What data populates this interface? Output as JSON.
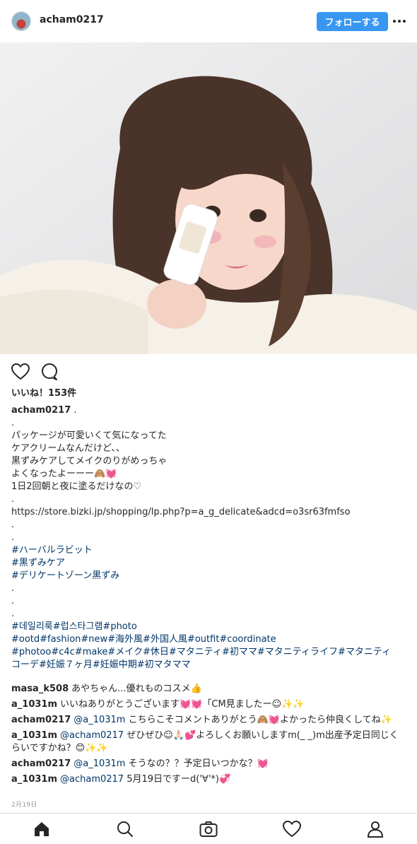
{
  "header": {
    "username": "acham0217",
    "follow_label": "フォローする"
  },
  "post": {
    "likes_label": "いいね！153件",
    "caption_author": "acham0217",
    "caption_lines": [
      ".",
      ".",
      "パッケージが可愛いくて気になってた",
      "ケアクリームなんだけど、、",
      "黒ずみケアしてメイクのりがめっちゃ",
      "よくなったよーーー🙈💓",
      "1日2回朝と夜に塗るだけなの♡",
      ".",
      "https://store.bizki.jp/shopping/lp.php?p=a_g_delicate&adcd=o3sr63fmfso",
      ".",
      ".",
      "#ハーバルラビット",
      "#黒ずみケア",
      "#デリケートゾーン黒ずみ",
      ".",
      ".",
      ".",
      "#데일리룩#럽스타그램#photo",
      "#ootd#fashion#new#海外風#外国人風#outfit#coordinate",
      "#photoo#c4c#make#メイク#休日#マタニティ#初ママ#マタニティライフ#マタニティ",
      "コーデ#妊娠７ヶ月#妊娠中期#初マタママ"
    ],
    "date": "2月19日"
  },
  "comments": [
    {
      "user": "masa_k508",
      "text": "あやちゃん...優れものコスメ👍"
    },
    {
      "user": "a_1031m",
      "text": "いいねありがとうございます💓💓「CM見ましたー☺✨✨"
    },
    {
      "user": "acham0217",
      "mention": "@a_1031m",
      "text": " こちらこそコメントありがとう🙈💓よかったら仲良くしてね✨"
    },
    {
      "user": "a_1031m",
      "mention": "@acham0217",
      "text": " ぜひぜひ☺🙏🏻💕よろしくお願いしますm(_ _)m出産予定日同じくらいですかね？😊✨✨"
    },
    {
      "user": "acham0217",
      "mention": "@a_1031m",
      "text": " そうなの？？予定日いつかな？💓"
    },
    {
      "user": "a_1031m",
      "mention": "@acham0217",
      "text": " 5月19日ですーd('∀'*)💞"
    }
  ],
  "icons": {
    "avatar": "avatar",
    "more": "more-icon",
    "like": "heart-icon",
    "comment": "comment-icon",
    "nav": [
      "home-icon",
      "search-icon",
      "camera-icon",
      "activity-heart-icon",
      "profile-icon"
    ]
  },
  "colors": {
    "accent": "#3897f0",
    "hashtag": "#003569",
    "muted": "#999999"
  }
}
